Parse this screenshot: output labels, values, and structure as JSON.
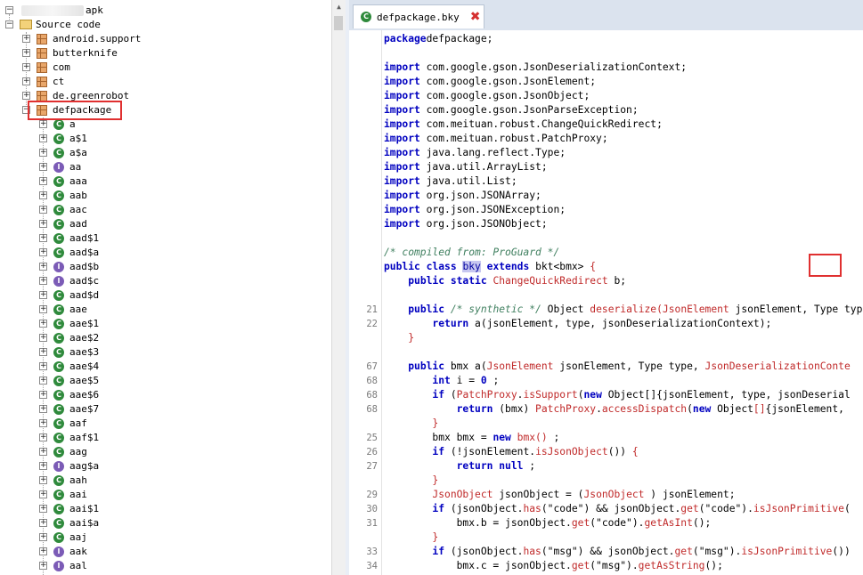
{
  "tree": {
    "root_label": "apk",
    "source_label": "Source code",
    "packages": [
      "android.support",
      "butterknife",
      "com",
      "ct",
      "de.greenrobot",
      "defpackage"
    ],
    "classes": [
      {
        "name": "a",
        "kind": "class"
      },
      {
        "name": "a$1",
        "kind": "class"
      },
      {
        "name": "a$a",
        "kind": "class"
      },
      {
        "name": "aa",
        "kind": "interface"
      },
      {
        "name": "aaa",
        "kind": "class"
      },
      {
        "name": "aab",
        "kind": "class"
      },
      {
        "name": "aac",
        "kind": "class"
      },
      {
        "name": "aad",
        "kind": "class"
      },
      {
        "name": "aad$1",
        "kind": "class"
      },
      {
        "name": "aad$a",
        "kind": "class"
      },
      {
        "name": "aad$b",
        "kind": "interface"
      },
      {
        "name": "aad$c",
        "kind": "interface"
      },
      {
        "name": "aad$d",
        "kind": "class"
      },
      {
        "name": "aae",
        "kind": "class"
      },
      {
        "name": "aae$1",
        "kind": "class"
      },
      {
        "name": "aae$2",
        "kind": "class"
      },
      {
        "name": "aae$3",
        "kind": "class"
      },
      {
        "name": "aae$4",
        "kind": "class"
      },
      {
        "name": "aae$5",
        "kind": "class"
      },
      {
        "name": "aae$6",
        "kind": "class"
      },
      {
        "name": "aae$7",
        "kind": "class"
      },
      {
        "name": "aaf",
        "kind": "class"
      },
      {
        "name": "aaf$1",
        "kind": "class"
      },
      {
        "name": "aag",
        "kind": "class"
      },
      {
        "name": "aag$a",
        "kind": "interface"
      },
      {
        "name": "aah",
        "kind": "class"
      },
      {
        "name": "aai",
        "kind": "class"
      },
      {
        "name": "aai$1",
        "kind": "class"
      },
      {
        "name": "aai$a",
        "kind": "class"
      },
      {
        "name": "aaj",
        "kind": "class"
      },
      {
        "name": "aak",
        "kind": "interface"
      },
      {
        "name": "aal",
        "kind": "interface"
      }
    ]
  },
  "editor": {
    "tab_title": "defpackage.bky",
    "lines": [
      {
        "n": "",
        "segs": [
          [
            "kw",
            "package"
          ],
          [
            "",
            "defpackage;"
          ]
        ]
      },
      {
        "n": "",
        "segs": []
      },
      {
        "n": "",
        "segs": [
          [
            "kw",
            "import"
          ],
          [
            "",
            " com.google.gson.JsonDeserializationContext;"
          ]
        ]
      },
      {
        "n": "",
        "segs": [
          [
            "kw",
            "import"
          ],
          [
            "",
            " com.google.gson.JsonElement;"
          ]
        ]
      },
      {
        "n": "",
        "segs": [
          [
            "kw",
            "import"
          ],
          [
            "",
            " com.google.gson.JsonObject;"
          ]
        ]
      },
      {
        "n": "",
        "segs": [
          [
            "kw",
            "import"
          ],
          [
            "",
            " com.google.gson.JsonParseException;"
          ]
        ]
      },
      {
        "n": "",
        "segs": [
          [
            "kw",
            "import"
          ],
          [
            "",
            " com.meituan.robust.ChangeQuickRedirect;"
          ]
        ]
      },
      {
        "n": "",
        "segs": [
          [
            "kw",
            "import"
          ],
          [
            "",
            " com.meituan.robust.PatchProxy;"
          ]
        ]
      },
      {
        "n": "",
        "segs": [
          [
            "kw",
            "import"
          ],
          [
            "",
            " java.lang.reflect.Type;"
          ]
        ]
      },
      {
        "n": "",
        "segs": [
          [
            "kw",
            "import"
          ],
          [
            "",
            " java.util.ArrayList;"
          ]
        ]
      },
      {
        "n": "",
        "segs": [
          [
            "kw",
            "import"
          ],
          [
            "",
            " java.util.List;"
          ]
        ]
      },
      {
        "n": "",
        "segs": [
          [
            "kw",
            "import"
          ],
          [
            "",
            " org.json.JSONArray;"
          ]
        ]
      },
      {
        "n": "",
        "segs": [
          [
            "kw",
            "import"
          ],
          [
            "",
            " org.json.JSONException;"
          ]
        ]
      },
      {
        "n": "",
        "segs": [
          [
            "kw",
            "import"
          ],
          [
            "",
            " org.json.JSONObject;"
          ]
        ]
      },
      {
        "n": "",
        "segs": []
      },
      {
        "n": "",
        "segs": [
          [
            "cm",
            "/* compiled from: ProGuard */"
          ]
        ]
      },
      {
        "n": "",
        "segs": [
          [
            "kw",
            "public class"
          ],
          [
            "",
            " "
          ],
          [
            "hl",
            "bky"
          ],
          [
            "",
            " "
          ],
          [
            "kw",
            "extends"
          ],
          [
            "",
            " bkt<bmx> "
          ],
          [
            "fn",
            "{"
          ]
        ]
      },
      {
        "n": "",
        "segs": [
          [
            "",
            "    "
          ],
          [
            "kw",
            "public static"
          ],
          [
            "",
            " "
          ],
          [
            "fn",
            "ChangeQuickRedirect"
          ],
          [
            "",
            " b;"
          ]
        ]
      },
      {
        "n": "",
        "segs": []
      },
      {
        "n": "21",
        "segs": [
          [
            "",
            "    "
          ],
          [
            "kw",
            "public"
          ],
          [
            "",
            " "
          ],
          [
            "cm",
            "/* synthetic */"
          ],
          [
            "",
            " Object "
          ],
          [
            "fn",
            "deserialize("
          ],
          [
            "fn",
            "JsonElement"
          ],
          [
            "",
            " jsonElement, Type type, JsonDeseri"
          ]
        ]
      },
      {
        "n": "22",
        "segs": [
          [
            "",
            "        "
          ],
          [
            "kw",
            "return"
          ],
          [
            "",
            " a(jsonElement, type, jsonDeserializationContext);"
          ]
        ]
      },
      {
        "n": "",
        "segs": [
          [
            "",
            "    "
          ],
          [
            "fn",
            "}"
          ]
        ]
      },
      {
        "n": "",
        "segs": []
      },
      {
        "n": "67",
        "segs": [
          [
            "",
            "    "
          ],
          [
            "kw",
            "public"
          ],
          [
            "",
            " bmx a("
          ],
          [
            "fn",
            "JsonElement"
          ],
          [
            "",
            " jsonElement, Type type, "
          ],
          [
            "fn",
            "JsonDeserializationConte"
          ]
        ]
      },
      {
        "n": "68",
        "segs": [
          [
            "",
            "        "
          ],
          [
            "kw",
            "int"
          ],
          [
            "",
            " i = "
          ],
          [
            "kw",
            "0"
          ],
          [
            "",
            " ;"
          ]
        ]
      },
      {
        "n": "68",
        "segs": [
          [
            "",
            "        "
          ],
          [
            "kw",
            "if"
          ],
          [
            "",
            " ("
          ],
          [
            "fn",
            "PatchProxy"
          ],
          [
            "",
            "."
          ],
          [
            "fn",
            "isSupport"
          ],
          [
            "",
            "("
          ],
          [
            "kw",
            "new"
          ],
          [
            "",
            " Object[]{jsonElement, type, jsonDeserial"
          ]
        ]
      },
      {
        "n": "68",
        "segs": [
          [
            "",
            "            "
          ],
          [
            "kw",
            "return"
          ],
          [
            "",
            " (bmx) "
          ],
          [
            "fn",
            "PatchProxy"
          ],
          [
            "",
            "."
          ],
          [
            "fn",
            "accessDispatch"
          ],
          [
            "",
            "("
          ],
          [
            "kw",
            "new"
          ],
          [
            "",
            " Object"
          ],
          [
            "fn",
            "[]"
          ],
          [
            "",
            "{jsonElement, "
          ]
        ]
      },
      {
        "n": "",
        "segs": [
          [
            "",
            "        "
          ],
          [
            "fn",
            "}"
          ]
        ]
      },
      {
        "n": "25",
        "segs": [
          [
            "",
            "        bmx bmx = "
          ],
          [
            "kw",
            "new"
          ],
          [
            "",
            " "
          ],
          [
            "fn",
            "bmx()"
          ],
          [
            "",
            " ;"
          ]
        ]
      },
      {
        "n": "26",
        "segs": [
          [
            "",
            "        "
          ],
          [
            "kw",
            "if"
          ],
          [
            "",
            " (!jsonElement."
          ],
          [
            "fn",
            "isJsonObject"
          ],
          [
            "",
            "()) "
          ],
          [
            "fn",
            "{"
          ]
        ]
      },
      {
        "n": "27",
        "segs": [
          [
            "",
            "            "
          ],
          [
            "kw",
            "return null"
          ],
          [
            "",
            " ;"
          ]
        ]
      },
      {
        "n": "",
        "segs": [
          [
            "",
            "        "
          ],
          [
            "fn",
            "}"
          ]
        ]
      },
      {
        "n": "29",
        "segs": [
          [
            "",
            "        "
          ],
          [
            "fn",
            "JsonObject"
          ],
          [
            "",
            " jsonObject = ("
          ],
          [
            "fn",
            "JsonObject"
          ],
          [
            "",
            " ) jsonElement;"
          ]
        ]
      },
      {
        "n": "30",
        "segs": [
          [
            "",
            "        "
          ],
          [
            "kw",
            "if"
          ],
          [
            "",
            " (jsonObject."
          ],
          [
            "fn",
            "has"
          ],
          [
            "",
            "(\"code\") && jsonObject."
          ],
          [
            "fn",
            "get"
          ],
          [
            "",
            "(\"code\")."
          ],
          [
            "fn",
            "isJsonPrimitive"
          ],
          [
            "",
            "("
          ]
        ]
      },
      {
        "n": "31",
        "segs": [
          [
            "",
            "            bmx.b = jsonObject."
          ],
          [
            "fn",
            "get"
          ],
          [
            "",
            "(\"code\")."
          ],
          [
            "fn",
            "getAsInt"
          ],
          [
            "",
            "();"
          ]
        ]
      },
      {
        "n": "",
        "segs": [
          [
            "",
            "        "
          ],
          [
            "fn",
            "}"
          ]
        ]
      },
      {
        "n": "33",
        "segs": [
          [
            "",
            "        "
          ],
          [
            "kw",
            "if"
          ],
          [
            "",
            " (jsonObject."
          ],
          [
            "fn",
            "has"
          ],
          [
            "",
            "(\"msg\") && jsonObject."
          ],
          [
            "fn",
            "get"
          ],
          [
            "",
            "(\"msg\")."
          ],
          [
            "fn",
            "isJsonPrimitive"
          ],
          [
            "",
            "())"
          ]
        ]
      },
      {
        "n": "34",
        "segs": [
          [
            "",
            "            bmx.c = jsonObject."
          ],
          [
            "fn",
            "get"
          ],
          [
            "",
            "(\"msg\")."
          ],
          [
            "fn",
            "getAsString"
          ],
          [
            "",
            "();"
          ]
        ]
      }
    ]
  }
}
